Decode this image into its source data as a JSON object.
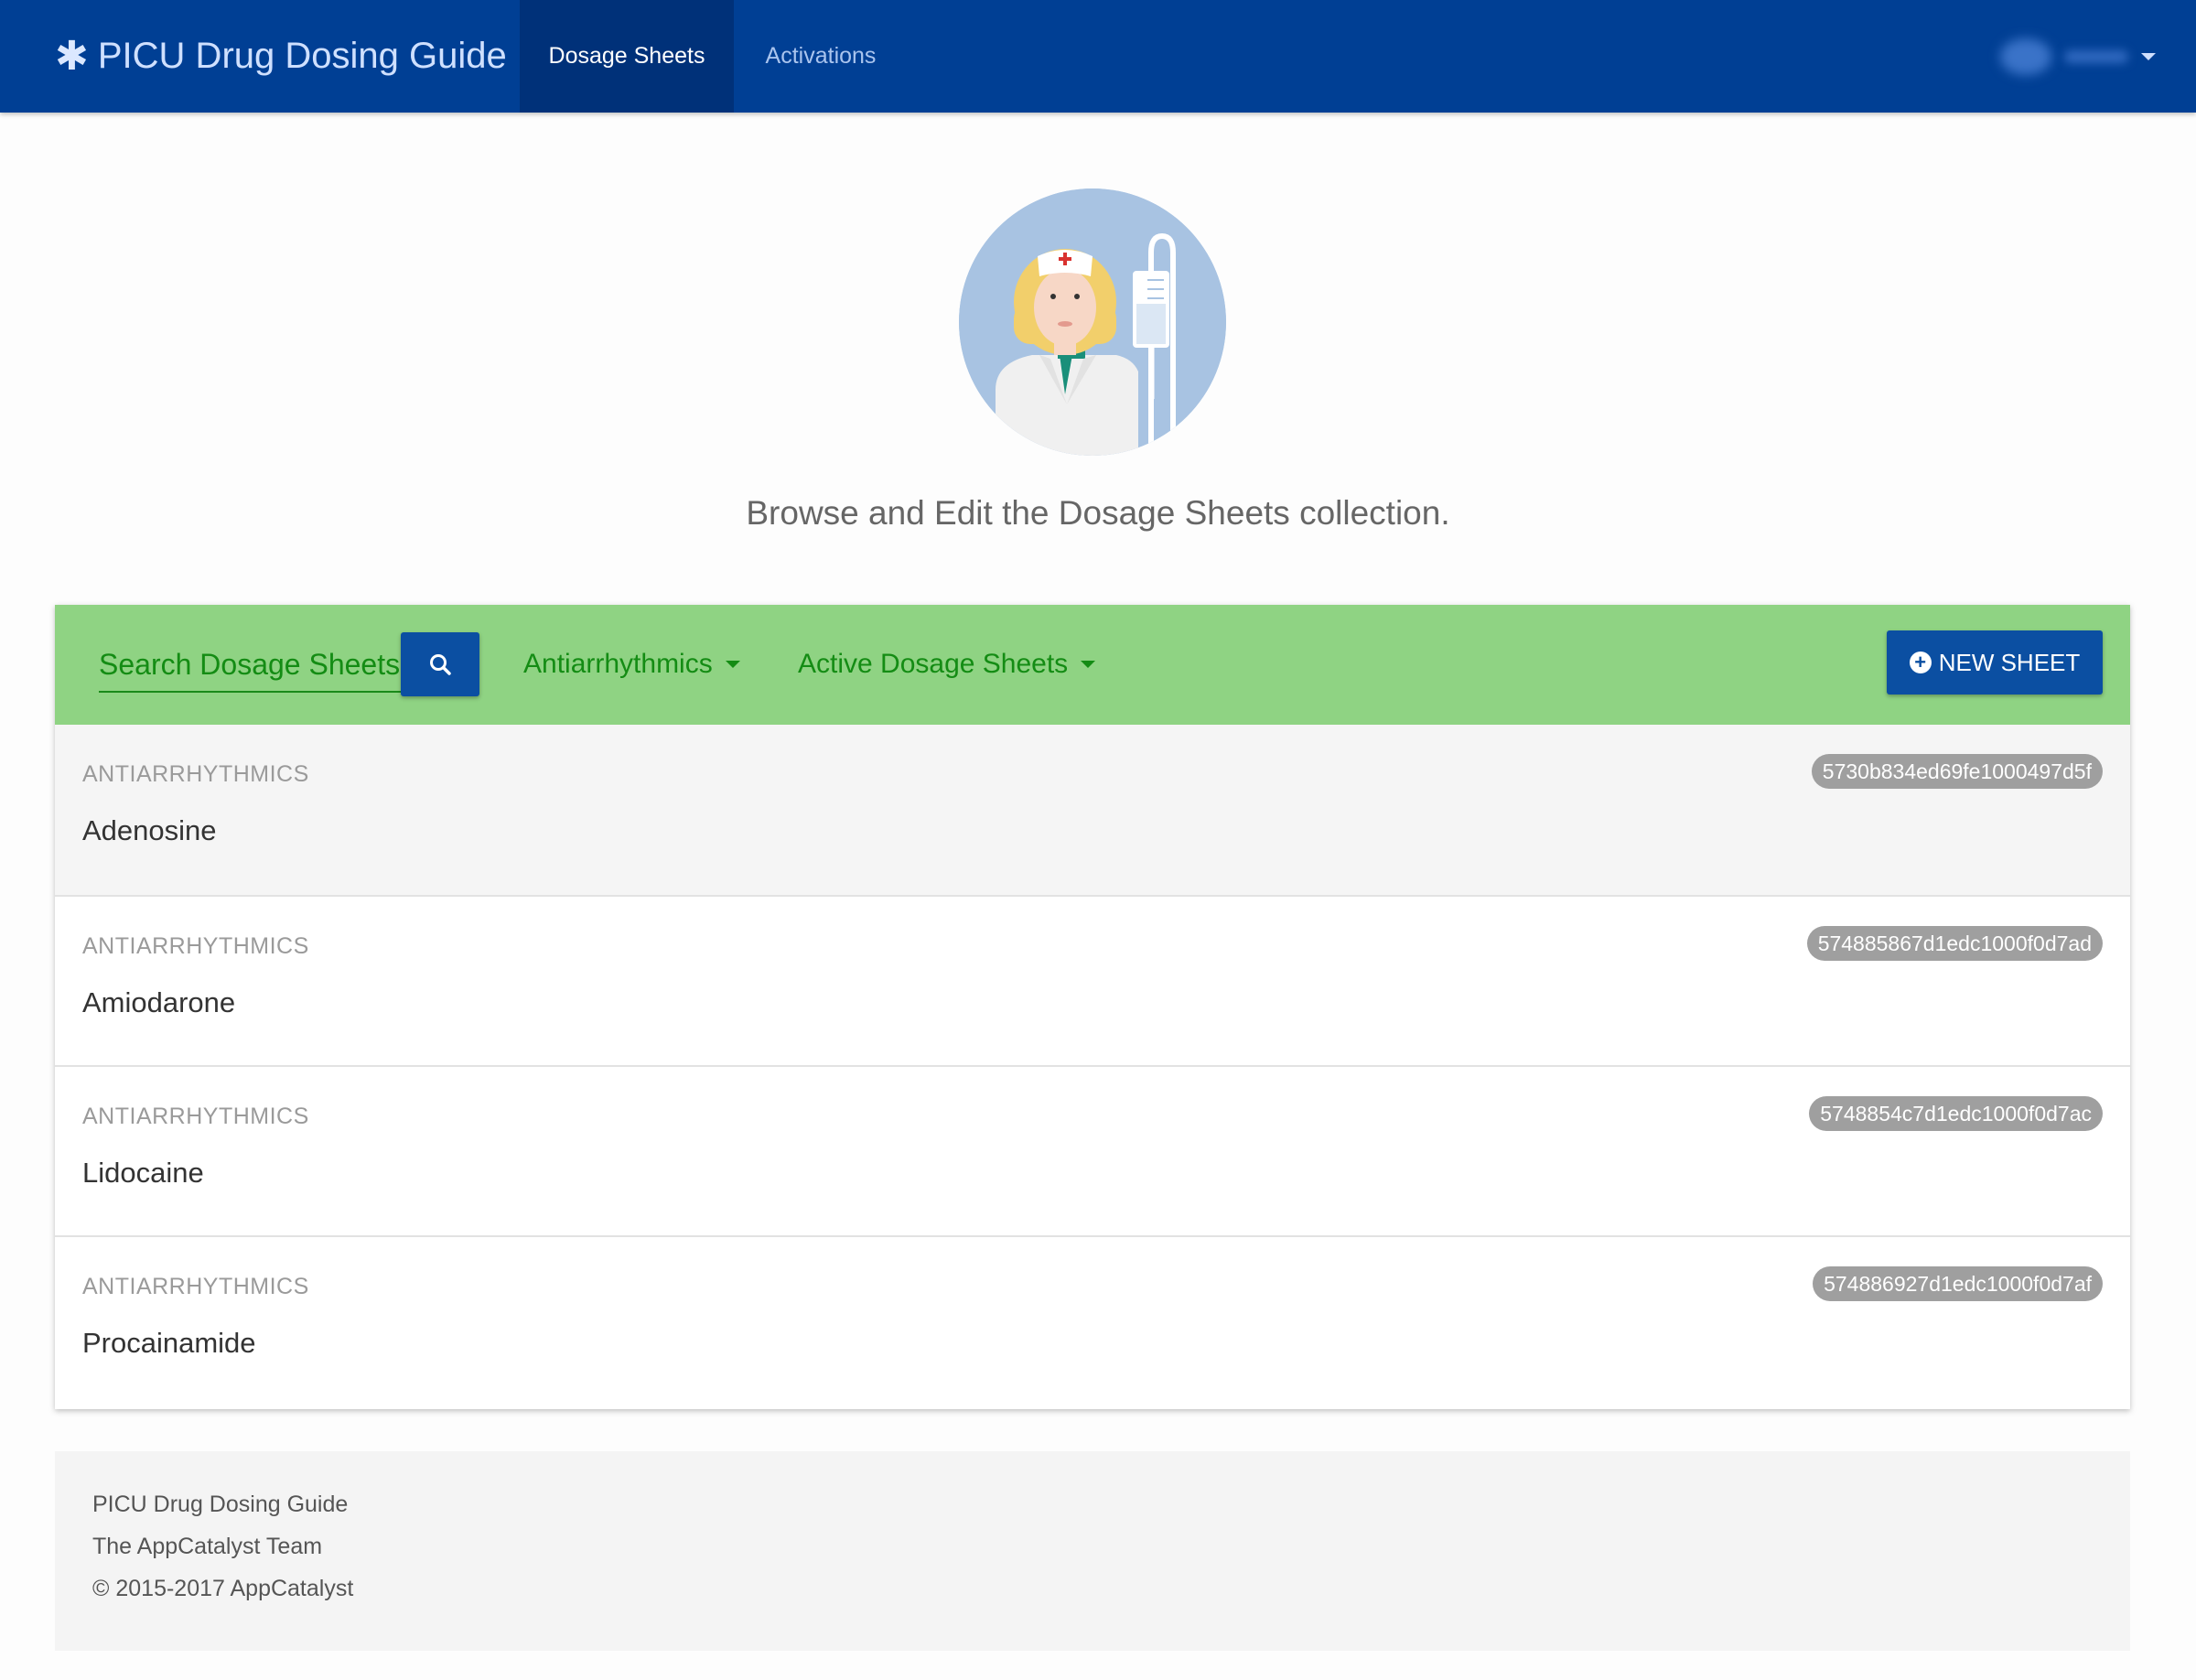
{
  "navbar": {
    "brand_icon": "asterisk-icon",
    "brand_title": "PICU Drug Dosing Guide",
    "tabs": [
      {
        "label": "Dosage Sheets",
        "active": true
      },
      {
        "label": "Activations",
        "active": false
      }
    ],
    "colors": {
      "background": "#003f94",
      "active_tab": "#003179"
    }
  },
  "hero": {
    "illustration": "nurse-with-iv-illustration",
    "subtitle": "Browse and Edit the Dosage Sheets collection."
  },
  "toolbar": {
    "search_placeholder": "Search Dosage Sheets",
    "search_icon": "search-icon",
    "category_filter": "Antiarrhythmics",
    "status_filter": "Active Dosage Sheets",
    "new_button_label": "NEW SHEET",
    "colors": {
      "background": "#8fd383",
      "accent": "#148c14",
      "button": "#0b4fa2"
    }
  },
  "sheets": [
    {
      "category": "ANTIARRHYTHMICS",
      "name": "Adenosine",
      "id": "5730b834ed69fe1000497d5f"
    },
    {
      "category": "ANTIARRHYTHMICS",
      "name": "Amiodarone",
      "id": "574885867d1edc1000f0d7ad"
    },
    {
      "category": "ANTIARRHYTHMICS",
      "name": "Lidocaine",
      "id": "5748854c7d1edc1000f0d7ac"
    },
    {
      "category": "ANTIARRHYTHMICS",
      "name": "Procainamide",
      "id": "574886927d1edc1000f0d7af"
    }
  ],
  "footer": {
    "line1": "PICU Drug Dosing Guide",
    "line2": "The AppCatalyst Team",
    "line3": "© 2015-2017 AppCatalyst"
  }
}
